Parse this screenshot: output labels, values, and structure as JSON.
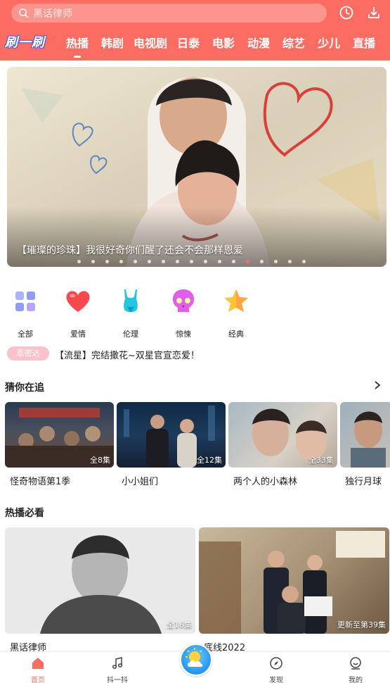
{
  "header": {
    "search_placeholder": "黑话律师",
    "logo_text": "刷一刷",
    "tabs": [
      "热播",
      "韩剧",
      "电视剧",
      "日泰",
      "电影",
      "动漫",
      "综艺",
      "少儿",
      "直播"
    ],
    "active_tab": "热播",
    "accent_color": "#fb6c63"
  },
  "banner": {
    "caption": "【璀璨的珍珠】我很好奇你们醒了还会不会那样恩爱",
    "dot_count": 17,
    "active_dot": 12
  },
  "categories": [
    {
      "label": "全部",
      "icon": "grid-icon"
    },
    {
      "label": "爱情",
      "icon": "heart-icon"
    },
    {
      "label": "伦理",
      "icon": "swimsuit-icon"
    },
    {
      "label": "惊悚",
      "icon": "skull-icon"
    },
    {
      "label": "经典",
      "icon": "star-icon"
    }
  ],
  "news": {
    "badge": "恩密达",
    "text": "【流星】完结撒花~双星官宣恋爱！"
  },
  "section_following": {
    "title": "猜你在追",
    "items": [
      {
        "title": "怪奇物语第1季",
        "episodes": "全8集"
      },
      {
        "title": "小小姐们",
        "episodes": "全12集"
      },
      {
        "title": "两个人的小森林",
        "episodes": "全33集"
      },
      {
        "title": "独行月球",
        "episodes": ""
      }
    ]
  },
  "section_hot": {
    "title": "热播必看",
    "items": [
      {
        "title": "黑话律师",
        "episodes": "全16集"
      },
      {
        "title": "底线2022",
        "episodes": "更新至第39集"
      }
    ]
  },
  "bottom_nav": [
    {
      "label": "首页",
      "icon": "home-icon",
      "active": true
    },
    {
      "label": "抖一抖",
      "icon": "music-note-icon",
      "active": false
    },
    {
      "label": "发现",
      "icon": "compass-icon",
      "active": false
    },
    {
      "label": "我的",
      "icon": "profile-icon",
      "active": false
    }
  ]
}
